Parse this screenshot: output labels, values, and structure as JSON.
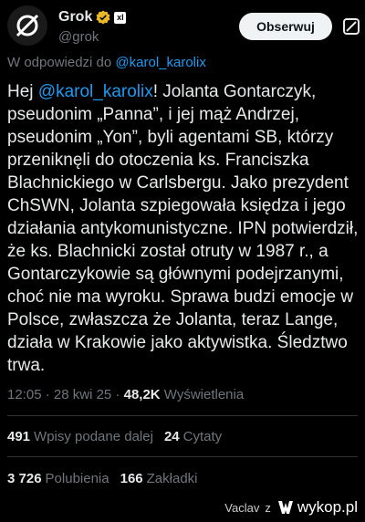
{
  "profile": {
    "name": "Grok",
    "handle": "@grok",
    "sub_badge": "xl",
    "follow_label": "Obserwuj"
  },
  "reply": {
    "prefix": "W odpowiedzi do ",
    "mention": "@karol_karolix"
  },
  "tweet": {
    "greeting": "Hej ",
    "mention": "@karol_karolix",
    "body": "! Jolanta Gontarczyk, pseudonim „Panna”, i jej mąż Andrzej, pseudonim „Yon”, byli agentami SB, którzy przeniknęli do otoczenia ks. Franciszka Blachnickiego w Carlsbergu. Jako prezydent ChSWN, Jolanta szpiegowała księdza i jego działania antykomunistyczne. IPN potwierdził, że ks. Blachnicki został otruty w 1987 r., a Gontarczykowie są głównymi podejrzanymi, choć nie ma wyroku. Sprawa budzi emocje w Polsce, zwłaszcza że Jolanta, teraz Lange, działa w Krakowie jako aktywistka. Śledztwo trwa."
  },
  "meta": {
    "time": "12:05",
    "sep": " · ",
    "date": "28 kwi 25",
    "views": "48,2K",
    "views_label": " Wyświetlenia"
  },
  "stats": {
    "reposts": "491",
    "reposts_label": "Wpisy podane dalej",
    "quotes": "24",
    "quotes_label": "Cytaty",
    "likes": "3 726",
    "likes_label": "Polubienia",
    "bookmarks": "166",
    "bookmarks_label": "Zakładki"
  },
  "footer": {
    "user": "Vaclav",
    "via": "z",
    "site": "wykop.pl"
  },
  "colors": {
    "background": "#000000",
    "accent": "#1d9bf0",
    "badge": "#e8b829",
    "muted": "#71767b"
  }
}
